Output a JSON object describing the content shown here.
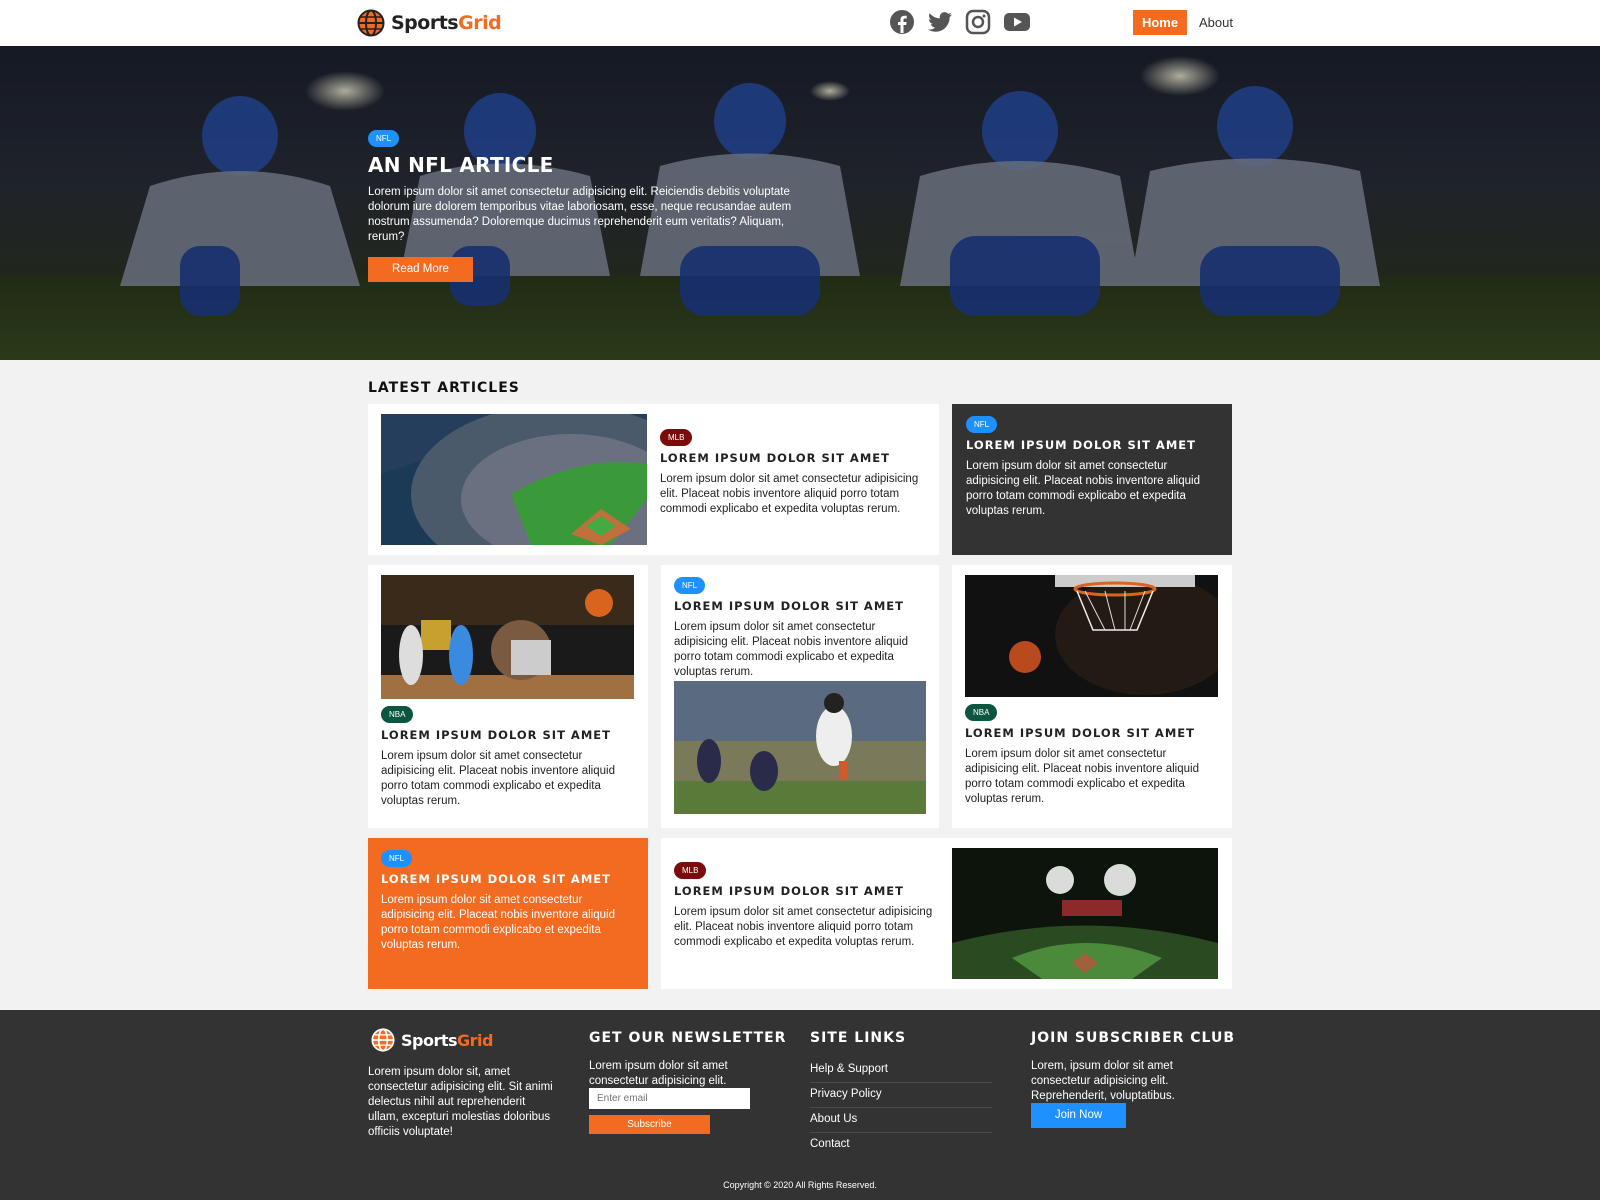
{
  "brand": {
    "name_part1": "Sports",
    "name_part2": "Grid"
  },
  "header": {
    "social": [
      "facebook-icon",
      "twitter-icon",
      "instagram-icon",
      "youtube-icon"
    ],
    "nav": {
      "home": "Home",
      "about": "About"
    }
  },
  "hero": {
    "badge": "NFL",
    "title": "AN NFL ARTICLE",
    "text": "Lorem ipsum dolor sit amet consectetur adipisicing elit. Reiciendis debitis voluptate dolorum iure dolorem temporibus vitae laboriosam, esse, neque recusandae autem nostrum assumenda? Doloremque ducimus reprehenderit eum veritatis? Aliquam, rerum?",
    "button": "Read More"
  },
  "latest": {
    "heading": "LATEST ARTICLES",
    "cards": [
      {
        "badge": "MLB",
        "title": "LOREM IPSUM DOLOR SIT AMET",
        "text": "Lorem ipsum dolor sit amet consectetur adipisicing elit. Placeat nobis inventore aliquid porro totam commodi explicabo et expedita voluptas rerum."
      },
      {
        "badge": "NFL",
        "title": "LOREM IPSUM DOLOR SIT AMET",
        "text": "Lorem ipsum dolor sit amet consectetur adipisicing elit. Placeat nobis inventore aliquid porro totam commodi explicabo et expedita voluptas rerum."
      },
      {
        "badge": "NBA",
        "title": "LOREM IPSUM DOLOR SIT AMET",
        "text": "Lorem ipsum dolor sit amet consectetur adipisicing elit. Placeat nobis inventore aliquid porro totam commodi explicabo et expedita voluptas rerum."
      },
      {
        "badge": "NFL",
        "title": "LOREM IPSUM DOLOR SIT AMET",
        "text": "Lorem ipsum dolor sit amet consectetur adipisicing elit. Placeat nobis inventore aliquid porro totam commodi explicabo et expedita voluptas rerum."
      },
      {
        "badge": "NBA",
        "title": "LOREM IPSUM DOLOR SIT AMET",
        "text": "Lorem ipsum dolor sit amet consectetur adipisicing elit. Placeat nobis inventore aliquid porro totam commodi explicabo et expedita voluptas rerum."
      },
      {
        "badge": "NFL",
        "title": "LOREM IPSUM DOLOR SIT AMET",
        "text": "Lorem ipsum dolor sit amet consectetur adipisicing elit. Placeat nobis inventore aliquid porro totam commodi explicabo et expedita voluptas rerum."
      },
      {
        "badge": "MLB",
        "title": "LOREM IPSUM DOLOR SIT AMET",
        "text": "Lorem ipsum dolor sit amet consectetur adipisicing elit. Placeat nobis inventore aliquid porro totam commodi explicabo et expedita voluptas rerum."
      }
    ]
  },
  "footer": {
    "about": "Lorem ipsum dolor sit, amet consectetur adipisicing elit. Sit animi delectus nihil aut reprehenderit ullam, excepturi molestias doloribus officiis voluptate!",
    "newsletter": {
      "title": "GET OUR NEWSLETTER",
      "text": "Lorem ipsum dolor sit amet consectetur adipisicing elit.",
      "placeholder": "Enter email",
      "button": "Subscribe"
    },
    "site_links": {
      "title": "SITE LINKS",
      "items": [
        "Help & Support",
        "Privacy Policy",
        "About Us",
        "Contact"
      ]
    },
    "subscriber": {
      "title": "JOIN SUBSCRIBER CLUB",
      "text": "Lorem, ipsum dolor sit amet consectetur adipisicing elit. Reprehenderit, voluptatibus.",
      "button": "Join Now"
    },
    "copyright": "Copyright © 2020 All Rights Reserved."
  },
  "colors": {
    "accent": "#f26b21",
    "nfl": "#1e90ff",
    "mlb": "#7a0c0c",
    "nba": "#0c5540",
    "dark": "#333333"
  }
}
